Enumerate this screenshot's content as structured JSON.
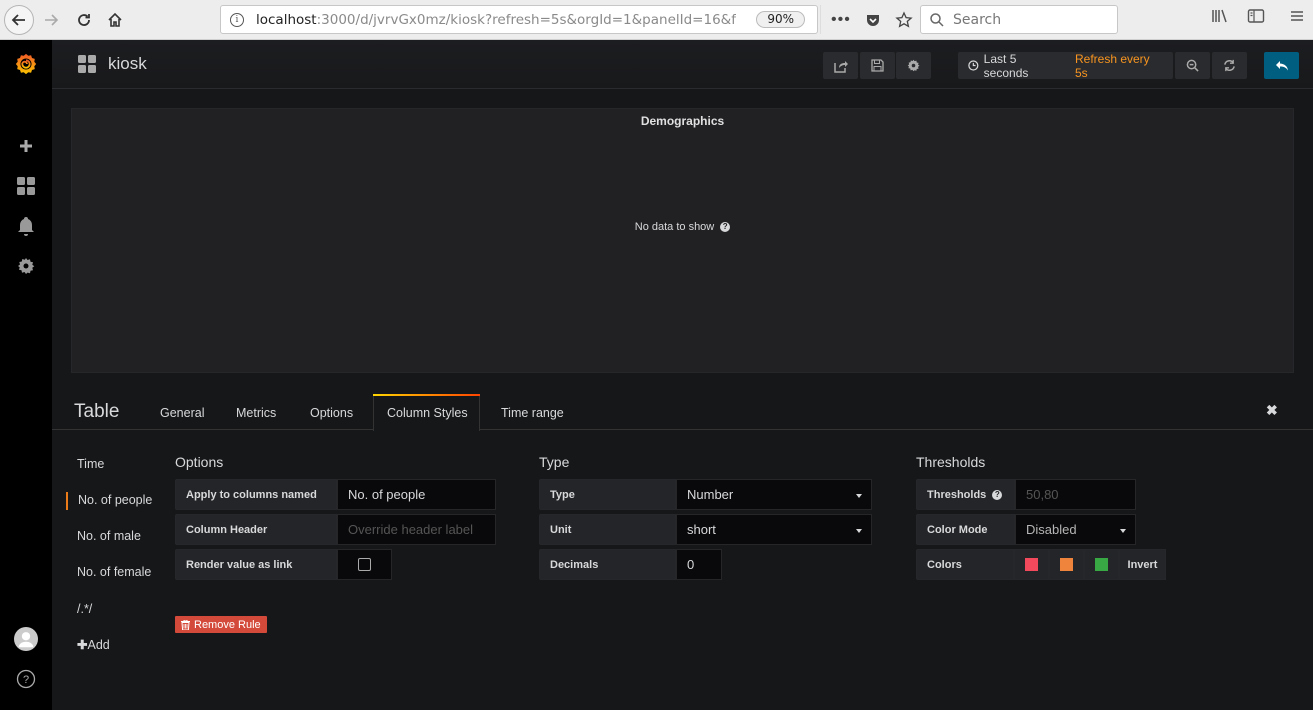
{
  "browser": {
    "url_host": "localhost",
    "url_rest": ":3000/d/jvrvGx0mz/kiosk?refresh=5s&orgId=1&panelId=16&f",
    "zoom_level": "90%",
    "search_placeholder": "Search"
  },
  "sidebar": {
    "items": [
      {
        "name": "grafana-logo",
        "icon": "grafana-logo"
      },
      {
        "name": "create",
        "icon": "plus-icon"
      },
      {
        "name": "dashboards",
        "icon": "apps-icon"
      },
      {
        "name": "alerting",
        "icon": "bell-icon"
      },
      {
        "name": "configuration",
        "icon": "gear-icon"
      },
      {
        "name": "profile",
        "icon": "avatar-icon"
      },
      {
        "name": "help",
        "icon": "question-circle-icon"
      }
    ]
  },
  "navbar": {
    "dashboard_title": "kiosk",
    "time_range": "Last 5 seconds",
    "refresh": "Refresh every 5s",
    "buttons": [
      "share-icon",
      "save-icon",
      "settings-icon",
      "zoom-out-icon",
      "refresh-icon",
      "back-to-dashboard-icon"
    ]
  },
  "panel": {
    "title": "Demographics",
    "no_data": "No data to show"
  },
  "editor": {
    "title": "Table",
    "tabs": [
      {
        "label": "General"
      },
      {
        "label": "Metrics"
      },
      {
        "label": "Options"
      },
      {
        "label": "Column Styles",
        "active": true
      },
      {
        "label": "Time range"
      }
    ],
    "column_list": [
      {
        "label": "Time"
      },
      {
        "label": "No. of people",
        "active": true
      },
      {
        "label": "No. of male"
      },
      {
        "label": "No. of female"
      },
      {
        "label": "/.*/"
      }
    ],
    "add_label": "Add",
    "remove_rule_label": "Remove Rule",
    "options": {
      "title": "Options",
      "apply_label": "Apply to columns named",
      "apply_value": "No.  of people",
      "header_label": "Column Header",
      "header_placeholder": "Override header label",
      "link_label": "Render value as link",
      "link_checked": false
    },
    "type": {
      "title": "Type",
      "type_label": "Type",
      "type_value": "Number",
      "unit_label": "Unit",
      "unit_value": "short",
      "decimals_label": "Decimals",
      "decimals_value": "0"
    },
    "thresholds": {
      "title": "Thresholds",
      "thresholds_label": "Thresholds",
      "thresholds_placeholder": "50,80",
      "color_mode_label": "Color Mode",
      "color_mode_value": "Disabled",
      "colors_label": "Colors",
      "colors": [
        "#f2495c",
        "#ef843c",
        "#37a843"
      ],
      "invert_label": "Invert"
    }
  },
  "colors": {
    "accent_orange": "#f79520",
    "primary_blue": "#005f81",
    "danger_red": "#d44a3a"
  }
}
